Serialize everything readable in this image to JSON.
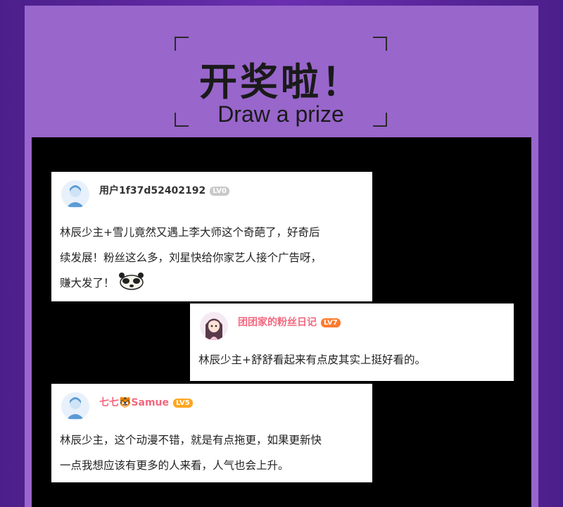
{
  "title": {
    "zh": "开奖啦！",
    "en": "Draw a prize"
  },
  "comments": [
    {
      "username": "用户1f37d52402192",
      "level": "LV0",
      "lines": [
        "林辰少主+雪儿竟然又遇上李大师这个奇葩了，好奇后",
        "续发展！粉丝这么多，刘星快给你家艺人接个广告呀，",
        "赚大发了！"
      ],
      "emoji": "panda-sticker"
    },
    {
      "username": "团团家的粉丝日记",
      "level": "LV7",
      "lines": [
        "林辰少主+舒舒看起来有点皮其实上挺好看的。"
      ]
    },
    {
      "username": "七七🐯Samue",
      "level": "LV5",
      "lines": [
        "林辰少主，这个动漫不错，就是有点拖更，如果更新快",
        "一点我想应该有更多的人来看，人气也会上升。"
      ]
    }
  ],
  "colors": {
    "panel": "#9966cc",
    "background": "#4b1f8a",
    "username_pink": "#f2677f"
  }
}
